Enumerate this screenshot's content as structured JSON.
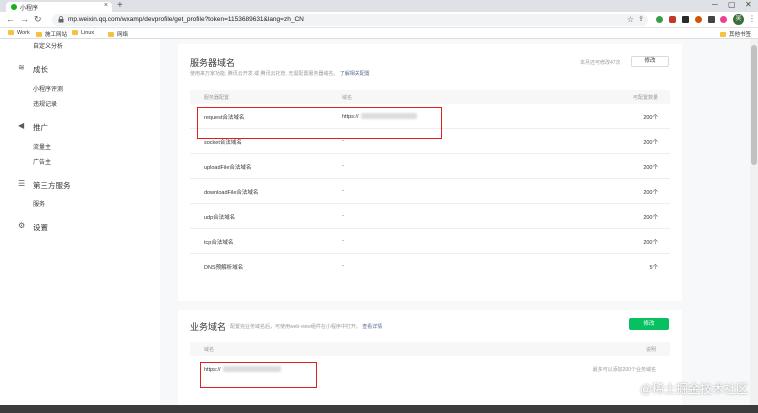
{
  "browser": {
    "tab_title": "小程序",
    "tab_close": "×",
    "new_tab": "+",
    "url": "mp.weixin.qq.com/wxamp/devprofile/get_profile?token=1153689631&lang=zh_CN",
    "profile_initial": "吴"
  },
  "bookmarks": [
    {
      "label": "Work"
    },
    {
      "label": "施工网站"
    },
    {
      "label": "Linux"
    },
    {
      "label": "网络"
    }
  ],
  "bookmarks_other": "其他书签",
  "sidebar": {
    "top_item": "自定义分析",
    "growth": {
      "label": "成长",
      "items": [
        "小程序评测",
        "违规记录"
      ]
    },
    "promote": {
      "label": "推广",
      "items": [
        "流量主",
        "广告主"
      ]
    },
    "third_party": {
      "label": "第三方服务",
      "items": [
        "服务"
      ]
    },
    "settings": {
      "label": "设置"
    }
  },
  "server_domain": {
    "title": "服务器域名",
    "description": "使用来万家功能, 腾讯云开发 或 腾讯云托管, 无需配置服务器域名。",
    "description_link": "了解相关配置",
    "quota": "本月还可修改47次",
    "edit_button": "修改",
    "headers": {
      "type": "服务器配置",
      "domain": "域名",
      "count": "可配置数量"
    },
    "rows": [
      {
        "type": "request合法域名",
        "domain": "https://",
        "count": "200个"
      },
      {
        "type": "socket合法域名",
        "domain": "-",
        "count": "200个"
      },
      {
        "type": "uploadFile合法域名",
        "domain": "-",
        "count": "200个"
      },
      {
        "type": "downloadFile合法域名",
        "domain": "-",
        "count": "200个"
      },
      {
        "type": "udp合法域名",
        "domain": "-",
        "count": "200个"
      },
      {
        "type": "tcp合法域名",
        "domain": "-",
        "count": "200个"
      },
      {
        "type": "DNS预解析域名",
        "domain": "-",
        "count": "5个"
      }
    ]
  },
  "business_domain": {
    "title": "业务域名",
    "description": "配置完业务域名后，可使用web-view组件在小程序中打开。",
    "description_link": "查看详情",
    "edit_button": "修改",
    "headers": {
      "domain": "域名",
      "note": "说明"
    },
    "rows": [
      {
        "domain": "https://",
        "note": "最多可以添加200个业务域名"
      }
    ]
  },
  "watermark": "@稀土掘金技术社区",
  "colors": {
    "accent": "#07c160",
    "highlight": "#e02020",
    "link": "#576b95"
  }
}
